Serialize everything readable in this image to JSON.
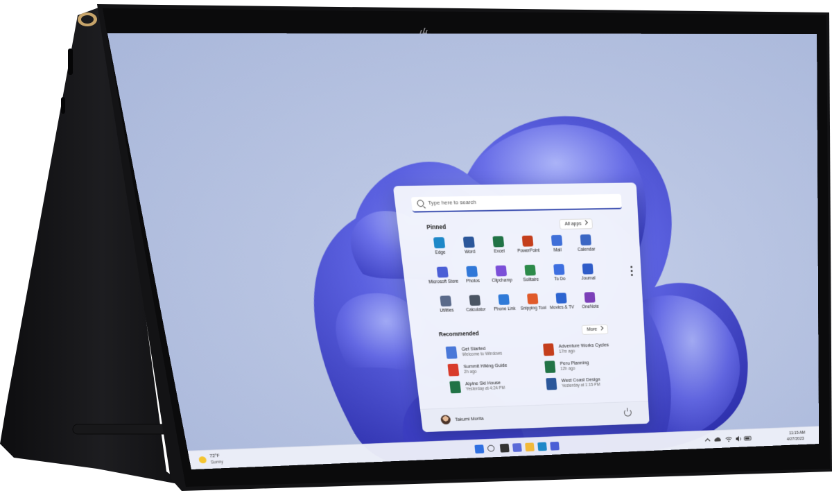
{
  "device": {
    "brand": "hp"
  },
  "start_menu": {
    "search": {
      "placeholder": "Type here to search"
    },
    "pinned": {
      "title": "Pinned",
      "all_apps_label": "All apps",
      "apps": [
        {
          "label": "Edge",
          "icon": "edge-icon",
          "color": "#1e88c8"
        },
        {
          "label": "Word",
          "icon": "word-icon",
          "color": "#2b579a"
        },
        {
          "label": "Excel",
          "icon": "excel-icon",
          "color": "#217346"
        },
        {
          "label": "PowerPoint",
          "icon": "powerpoint-icon",
          "color": "#c43e1c"
        },
        {
          "label": "Mail",
          "icon": "mail-icon",
          "color": "#3f6fd8"
        },
        {
          "label": "Calendar",
          "icon": "calendar-icon",
          "color": "#3a66c4"
        },
        {
          "label": "Microsoft Store",
          "icon": "store-icon",
          "color": "#4b5fd6"
        },
        {
          "label": "Photos",
          "icon": "photos-icon",
          "color": "#3078d8"
        },
        {
          "label": "Clipchamp",
          "icon": "clipchamp-icon",
          "color": "#7b4fd8"
        },
        {
          "label": "Solitaire",
          "icon": "solitaire-icon",
          "color": "#2c8a4a"
        },
        {
          "label": "To Do",
          "icon": "todo-icon",
          "color": "#3d6fe0"
        },
        {
          "label": "Journal",
          "icon": "journal-icon",
          "color": "#2f5cc8"
        },
        {
          "label": "Utilities",
          "icon": "utilities-icon",
          "color": "#5a6a8a"
        },
        {
          "label": "Calculator",
          "icon": "calculator-icon",
          "color": "#4b5563"
        },
        {
          "label": "Phone Link",
          "icon": "phone-link-icon",
          "color": "#2f7ad8"
        },
        {
          "label": "Snipping Tool",
          "icon": "snipping-tool-icon",
          "color": "#e05a2a"
        },
        {
          "label": "Movies & TV",
          "icon": "movies-tv-icon",
          "color": "#2d64d0"
        },
        {
          "label": "OneNote",
          "icon": "onenote-icon",
          "color": "#7b3fb8"
        }
      ]
    },
    "recommended": {
      "title": "Recommended",
      "more_label": "More",
      "items": [
        {
          "title": "Get Started",
          "subtitle": "Welcome to Windows",
          "icon": "get-started-icon",
          "color": "#4a78d8"
        },
        {
          "title": "Adventure Works Cycles",
          "subtitle": "17m ago",
          "icon": "powerpoint-file-icon",
          "color": "#c43e1c"
        },
        {
          "title": "Summit Hiking Guide",
          "subtitle": "2h ago",
          "icon": "pdf-file-icon",
          "color": "#d83b2b"
        },
        {
          "title": "Peru Planning",
          "subtitle": "12h ago",
          "icon": "excel-file-icon",
          "color": "#217346"
        },
        {
          "title": "Alpine Ski House",
          "subtitle": "Yesterday at 4:24 PM",
          "icon": "excel-file-icon",
          "color": "#217346"
        },
        {
          "title": "West Coast Design",
          "subtitle": "Yesterday at 1:15 PM",
          "icon": "word-file-icon",
          "color": "#2b579a"
        }
      ]
    },
    "user": {
      "name": "Takumi Morita"
    }
  },
  "taskbar": {
    "weather": {
      "temp": "72°F",
      "condition": "Sunny"
    },
    "icons": [
      {
        "icon": "windows-start-icon",
        "color": "#2f6fe0"
      },
      {
        "icon": "search-icon",
        "color": "#222222"
      },
      {
        "icon": "task-view-icon",
        "color": "#333333"
      },
      {
        "icon": "chat-icon",
        "color": "#5a6ad8"
      },
      {
        "icon": "file-explorer-icon",
        "color": "#f2b93a"
      },
      {
        "icon": "edge-icon",
        "color": "#1e88c8"
      },
      {
        "icon": "store-icon",
        "color": "#4b5fd6"
      }
    ],
    "clock": {
      "time": "11:15 AM",
      "date": "4/27/2023"
    }
  }
}
